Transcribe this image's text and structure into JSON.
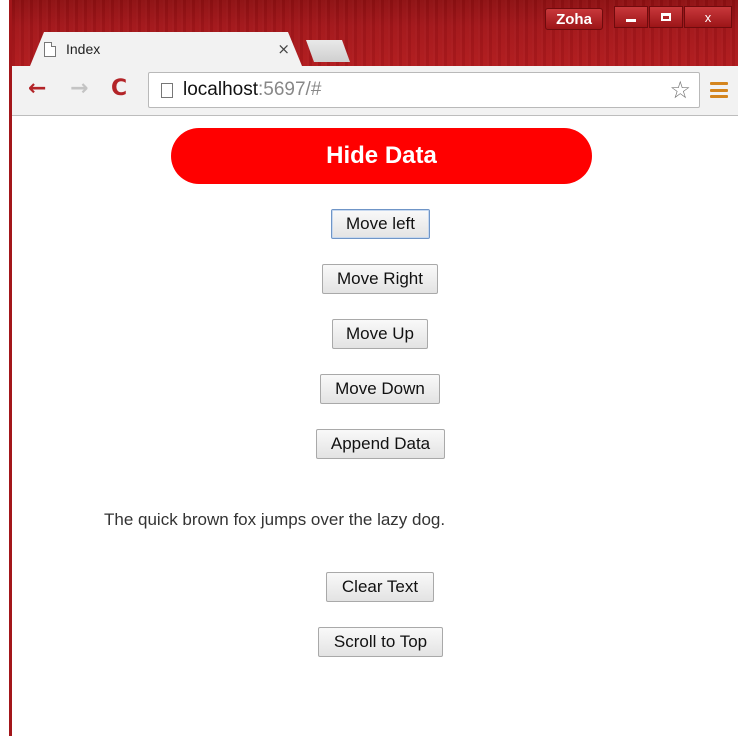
{
  "window": {
    "profile_name": "Zoha",
    "controls": {
      "close_glyph": "x"
    }
  },
  "tab": {
    "title": "Index",
    "close_glyph": "×"
  },
  "address_bar": {
    "host": "localhost",
    "rest": ":5697/#"
  },
  "page": {
    "hide_button_label": "Hide Data",
    "buttons": [
      "Move left",
      "Move Right",
      "Move Up",
      "Move Down",
      "Append Data"
    ],
    "sentence": "The quick brown fox jumps over the lazy dog.",
    "clear_button_label": "Clear Text",
    "scroll_button_label": "Scroll to Top"
  },
  "colors": {
    "hide_button_bg": "#ff0000",
    "frame_red": "#a3161a",
    "menu_orange": "#d4851e"
  },
  "icons": {
    "back": "back-arrow-icon",
    "forward": "forward-arrow-icon",
    "reload": "reload-icon",
    "page": "page-icon",
    "bookmark": "star-icon",
    "menu": "hamburger-menu-icon"
  }
}
